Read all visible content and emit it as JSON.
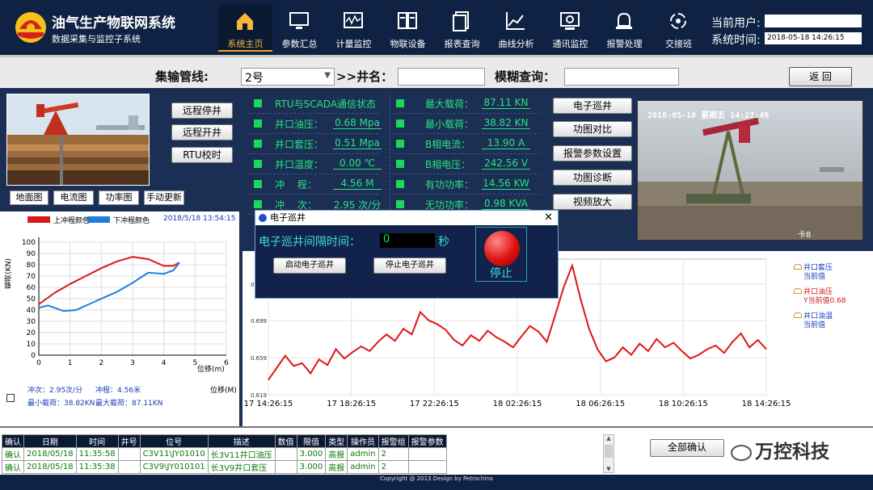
{
  "header": {
    "title": "油气生产物联网系统",
    "subtitle": "数据采集与监控子系统",
    "nav": [
      {
        "label": "系统主页",
        "icon": "home-icon"
      },
      {
        "label": "参数汇总",
        "icon": "monitor-icon"
      },
      {
        "label": "计量监控",
        "icon": "waveform-icon"
      },
      {
        "label": "物联设备",
        "icon": "device-icon"
      },
      {
        "label": "报表查询",
        "icon": "report-icon"
      },
      {
        "label": "曲线分析",
        "icon": "curve-icon"
      },
      {
        "label": "通讯监控",
        "icon": "comm-icon"
      },
      {
        "label": "报警处理",
        "icon": "alarm-icon"
      },
      {
        "label": "交接班",
        "icon": "shift-icon"
      }
    ],
    "user_label": "当前用户:",
    "time_label": "系统时间:",
    "time_value": "2018-05-18 14:26:15"
  },
  "filter": {
    "pipeline_label": "集输管线:",
    "pipeline_value": "2号",
    "well_label": ">>井名：",
    "fuzzy_label": "模糊查询：",
    "back_label": "返 回"
  },
  "controls": {
    "remote_stop": "远程停井",
    "remote_start": "远程开井",
    "rtu_calib": "RTU校时",
    "map_buttons": [
      "地面图",
      "电流图",
      "功率图",
      "手动更新"
    ],
    "right_buttons": [
      "电子巡井",
      "功图对比",
      "报警参数设置",
      "功图诊断",
      "视频放大"
    ]
  },
  "metrics_left": [
    {
      "label": "RTU与SCADA通信状态",
      "value": "",
      "unit": ""
    },
    {
      "label": "井口油压：",
      "value": "0.68",
      "unit": "Mpa"
    },
    {
      "label": "井口套压：",
      "value": "0.51",
      "unit": "Mpa"
    },
    {
      "label": "井口温度：",
      "value": "0.00",
      "unit": "℃"
    },
    {
      "label": "冲　 程：",
      "value": "4.56",
      "unit": "M"
    },
    {
      "label": "冲　 次：",
      "value": "2.95",
      "unit": "次/分"
    }
  ],
  "metrics_right": [
    {
      "label": "最大载荷：",
      "value": "87.11",
      "unit": "KN"
    },
    {
      "label": "最小载荷：",
      "value": "38.82",
      "unit": "KN"
    },
    {
      "label": "B相电流：",
      "value": "13.90",
      "unit": "A"
    },
    {
      "label": "B相电压：",
      "value": "242.56",
      "unit": "V"
    },
    {
      "label": "有功功率：",
      "value": "14.56",
      "unit": "KW"
    },
    {
      "label": "无功功率：",
      "value": "0.98",
      "unit": "KVA"
    }
  ],
  "camera": {
    "timestamp": "2018-05-18 星期五 14:27:49",
    "channel": "卡8"
  },
  "dyno": {
    "legend_up": "上冲程颜色",
    "legend_down": "下冲程颜色",
    "date": "2018/5/18 13:54:15",
    "ylabel": "载荷(KN)",
    "xlabel": "位移(m)",
    "xlabel2": "位移(M)",
    "stat_stroke_rate": "冲次：2.95次/分",
    "stat_stroke": "冲程：4.56米",
    "stat_min": "最小载荷：38.82KN",
    "stat_max": "最大载荷：87.11KN"
  },
  "trend_legend": [
    {
      "name": "井口套压",
      "sub": "当前值",
      "color": "#1a3fbf"
    },
    {
      "name": "井口油压",
      "sub": "Y当前值0.68",
      "color": "#d11a1a"
    },
    {
      "name": "井口油温",
      "sub": "当前值",
      "color": "#1a3fbf"
    }
  ],
  "modal": {
    "title": "电子巡井",
    "interval_label": "电子巡井间隔时间：",
    "interval_value": "0",
    "unit": "秒",
    "start_btn": "启动电子巡井",
    "stop_btn": "停止电子巡井",
    "status": "停止"
  },
  "watermark": "万控科技",
  "alarm_table": {
    "headers": [
      "确认",
      "日期",
      "时间",
      "井号",
      "位号",
      "描述",
      "数值",
      "限值",
      "类型",
      "操作员",
      "报警组",
      "报警参数"
    ],
    "rows": [
      [
        "确认",
        "2018/05/18",
        "11:35:58",
        "",
        "C3V11\\JY01010",
        "长3V11井口油压",
        "",
        "3.000",
        "高报",
        "admin",
        "2",
        ""
      ],
      [
        "确认",
        "2018/05/18",
        "11:35:38",
        "",
        "C3V9\\JY010101",
        "长3V9井口套压",
        "",
        "3.000",
        "高报",
        "admin",
        "2",
        ""
      ]
    ],
    "confirm_all": "全部确认"
  },
  "brand_badge": "万控科技",
  "footer": "Copyright @ 2013 Design by Petrochina",
  "chart_data": [
    {
      "type": "line",
      "title": "",
      "xlabel": "位移(m)",
      "ylabel": "载荷(KN)",
      "xlim": [
        0,
        6
      ],
      "ylim": [
        0,
        100
      ],
      "series": [
        {
          "name": "上冲程颜色",
          "x": [
            0,
            0.5,
            1,
            1.5,
            2,
            2.5,
            3,
            3.5,
            4,
            4.3,
            4.5
          ],
          "y": [
            45,
            55,
            63,
            70,
            77,
            83,
            87,
            85,
            79,
            79,
            82
          ]
        },
        {
          "name": "下冲程颜色",
          "x": [
            0,
            0.3,
            0.8,
            1.2,
            1.6,
            2,
            2.5,
            3,
            3.5,
            4,
            4.3,
            4.5
          ],
          "y": [
            42,
            44,
            39,
            40,
            45,
            50,
            56,
            64,
            73,
            72,
            75,
            82
          ]
        }
      ]
    },
    {
      "type": "line",
      "title": "",
      "xticks": [
        "17 14:26:15",
        "17 18:26:15",
        "17 22:26:15",
        "18 02:26:15",
        "18 06:26:15",
        "18 10:26:15",
        "18 14:26:15"
      ],
      "yticks_left": [
        0.619,
        0.659,
        0.699,
        0.738
      ],
      "series": [
        {
          "name": "井口油压",
          "values": [
            0.635,
            0.648,
            0.661,
            0.65,
            0.653,
            0.642,
            0.657,
            0.651,
            0.668,
            0.658,
            0.665,
            0.671,
            0.666,
            0.676,
            0.684,
            0.677,
            0.69,
            0.684,
            0.708,
            0.699,
            0.695,
            0.689,
            0.678,
            0.672,
            0.683,
            0.677,
            0.688,
            0.681,
            0.676,
            0.67,
            0.682,
            0.693,
            0.687,
            0.676,
            0.705,
            0.735,
            0.758,
            0.722,
            0.69,
            0.668,
            0.655,
            0.659,
            0.67,
            0.662,
            0.674,
            0.666,
            0.679,
            0.67,
            0.675,
            0.666,
            0.658,
            0.662,
            0.668,
            0.672,
            0.664,
            0.676,
            0.685,
            0.67,
            0.678,
            0.668
          ]
        }
      ]
    }
  ]
}
